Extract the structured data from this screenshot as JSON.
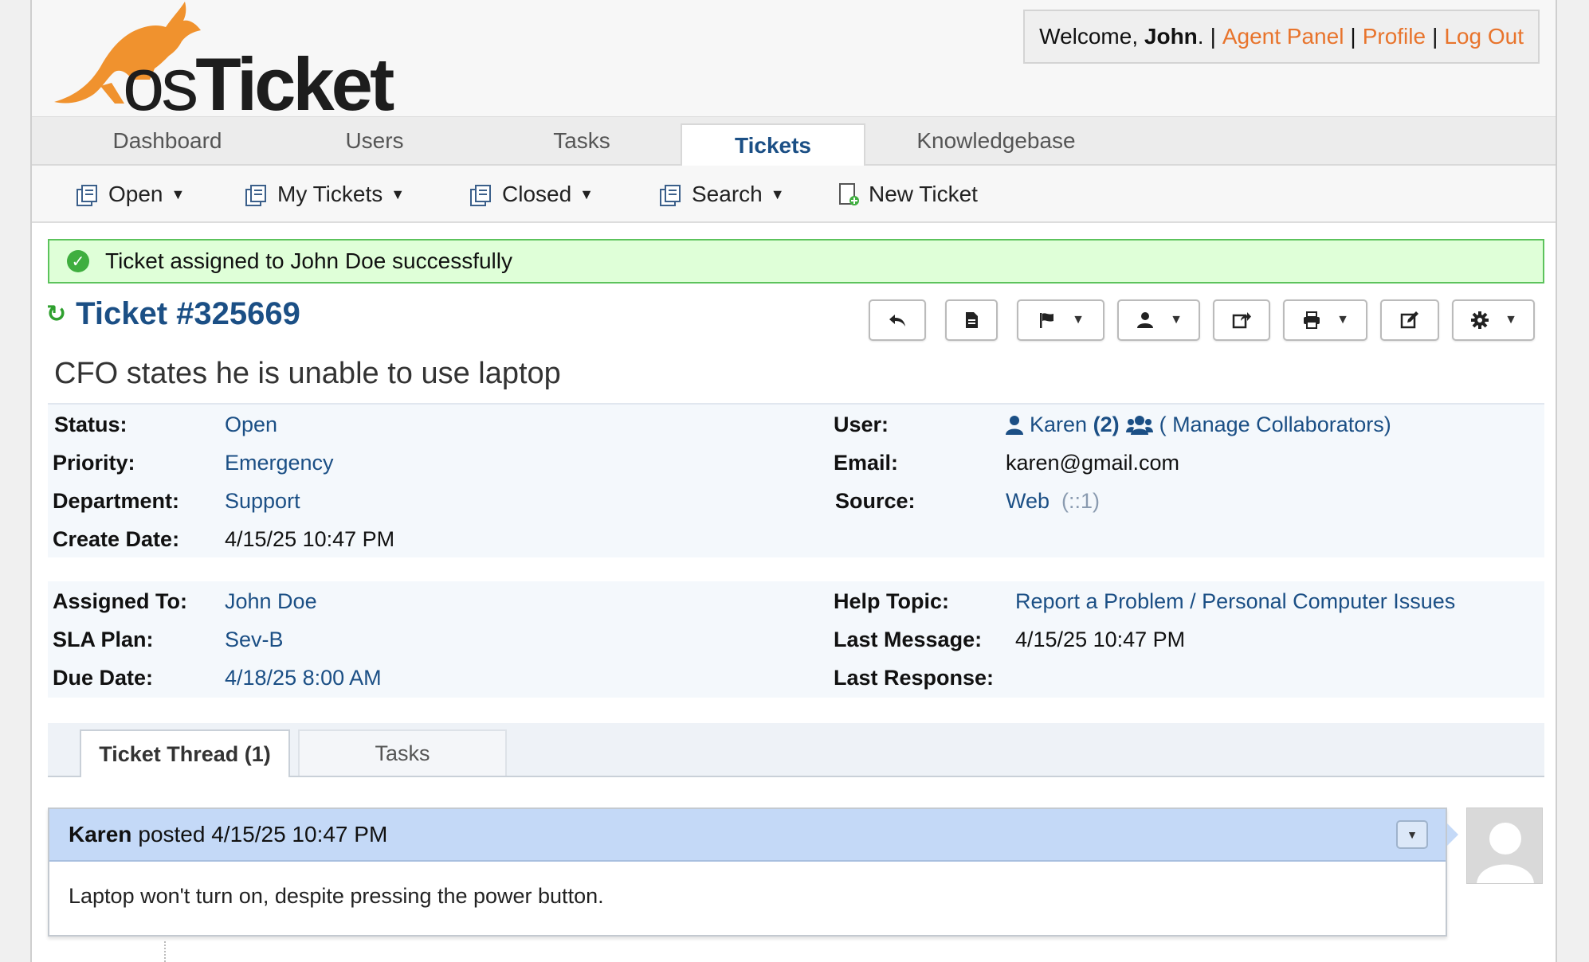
{
  "header": {
    "logo_text_os": "os",
    "logo_text_ticket": "Ticket",
    "welcome_prefix": "Welcome,",
    "welcome_name": "John",
    "welcome_suffix": ".",
    "links": [
      "Agent Panel",
      "Profile",
      "Log Out"
    ]
  },
  "nav": {
    "tabs": [
      "Dashboard",
      "Users",
      "Tasks",
      "Tickets",
      "Knowledgebase"
    ],
    "active": "Tickets"
  },
  "subnav": {
    "items": [
      "Open",
      "My Tickets",
      "Closed",
      "Search",
      "New Ticket"
    ]
  },
  "alert": {
    "message": "Ticket assigned to John Doe successfully"
  },
  "ticket": {
    "title": "Ticket #325669",
    "subject": "CFO states he is unable to use laptop"
  },
  "info": {
    "status_label": "Status:",
    "status": "Open",
    "priority_label": "Priority:",
    "priority": "Emergency",
    "department_label": "Department:",
    "department": "Support",
    "create_date_label": "Create Date:",
    "create_date": "4/15/25 10:47 PM",
    "user_label": "User:",
    "user": "Karen",
    "user_count": "(2)",
    "collaborators": "( Manage Collaborators)",
    "email_label": "Email:",
    "email": "karen@gmail.com",
    "source_label": "Source:",
    "source": "Web",
    "source_ip": "(::1)"
  },
  "assign": {
    "assigned_to_label": "Assigned To:",
    "assigned_to": "John Doe",
    "sla_label": "SLA Plan:",
    "sla": "Sev-B",
    "due_date_label": "Due Date:",
    "due_date": "4/18/25 8:00 AM",
    "help_topic_label": "Help Topic:",
    "help_topic": "Report a Problem / Personal Computer Issues",
    "last_message_label": "Last Message:",
    "last_message": "4/15/25 10:47 PM",
    "last_response_label": "Last Response:"
  },
  "thread": {
    "tabs": [
      "Ticket Thread (1)",
      "Tasks"
    ],
    "entry_author": "Karen",
    "entry_meta": "posted 4/15/25 10:47 PM",
    "entry_body": "Laptop won't turn on, despite pressing the power button."
  },
  "colors": {
    "brand_orange": "#e8742c",
    "link_blue": "#1b4f85",
    "success_green": "#5cc35c",
    "thread_header": "#c4d9f7"
  }
}
